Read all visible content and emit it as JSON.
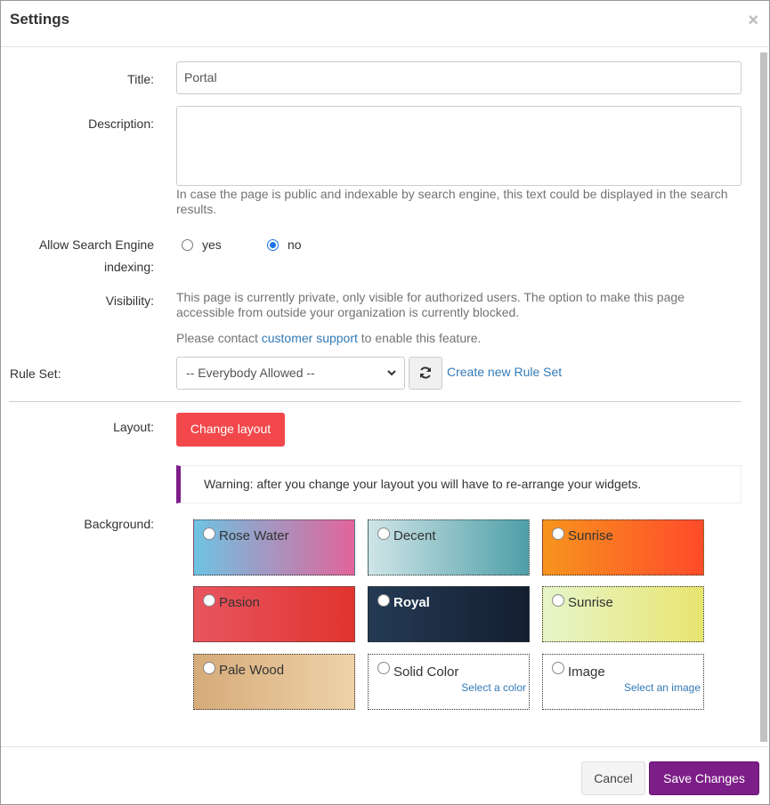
{
  "modal": {
    "title": "Settings",
    "close": "×"
  },
  "form": {
    "title_label": "Title:",
    "title_value": "Portal",
    "description_label": "Description:",
    "description_value": "",
    "description_help": "In case the page is public and indexable by search engine, this text could be displayed in the search results.",
    "indexing_label_line1": "Allow Search Engine",
    "indexing_label_line2": "indexing:",
    "indexing_yes": "yes",
    "indexing_no": "no",
    "indexing_selected": "no",
    "visibility_label": "Visibility:",
    "visibility_text": "This page is currently private, only visible for authorized users. The option to make this page accessible from outside your organization is currently blocked.",
    "contact_pre": "Please contact ",
    "contact_link": "customer support",
    "contact_post": " to enable this feature.",
    "ruleset_label": "Rule Set:",
    "ruleset_value": "-- Everybody Allowed --",
    "ruleset_create": "Create new Rule Set",
    "layout_label": "Layout:",
    "layout_button": "Change layout",
    "layout_warning": "Warning: after you change your layout you will have to re-arrange your widgets.",
    "background_label": "Background:"
  },
  "backgrounds": [
    {
      "label": "Rose Water",
      "colors": [
        "#6ec3e3",
        "#e2649a"
      ]
    },
    {
      "label": "Decent",
      "colors": [
        "#cfe5e8",
        "#4e9fa8"
      ]
    },
    {
      "label": "Sunrise",
      "colors": [
        "#f7941d",
        "#ff4b2b"
      ]
    },
    {
      "label": "Pasion",
      "colors": [
        "#e8555f",
        "#e0342f"
      ]
    },
    {
      "label": "Royal",
      "colors": [
        "#243b55",
        "#141e30"
      ]
    },
    {
      "label": "Sunrise",
      "colors": [
        "#e6f5c9",
        "#e8e570"
      ]
    },
    {
      "label": "Pale Wood",
      "colors": [
        "#d6ab7a",
        "#eed2a8"
      ]
    },
    {
      "label": "Solid Color",
      "sub": "Select a color"
    },
    {
      "label": "Image",
      "sub": "Select an image"
    }
  ],
  "footer": {
    "cancel": "Cancel",
    "save": "Save Changes"
  },
  "colors": {
    "accent": "#7c1e87",
    "danger": "#f2484b",
    "link": "#337ab7"
  }
}
